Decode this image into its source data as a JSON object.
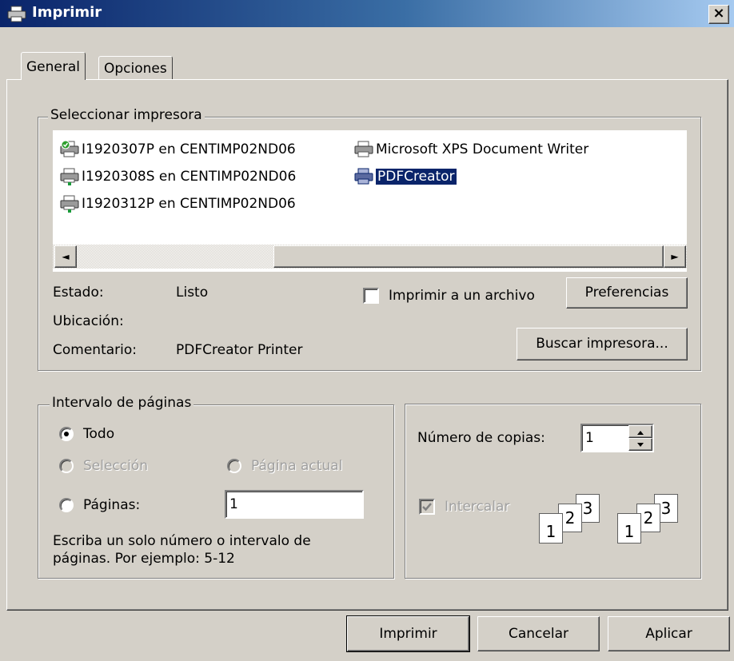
{
  "window": {
    "title": "Imprimir",
    "close_label": "×"
  },
  "tabs": [
    {
      "label": "General"
    },
    {
      "label": "Opciones"
    }
  ],
  "printer_group": {
    "legend": "Seleccionar impresora",
    "printers": [
      {
        "name": "I1920307P en CENTIMP02ND06"
      },
      {
        "name": "I1920308S en CENTIMP02ND06"
      },
      {
        "name": "I1920312P en CENTIMP02ND06"
      },
      {
        "name": "Microsoft XPS Document Writer"
      },
      {
        "name": "PDFCreator",
        "selected": true
      }
    ],
    "scroll_left": "◄",
    "scroll_right": "►",
    "status_label": "Estado:",
    "status_value": "Listo",
    "location_label": "Ubicación:",
    "location_value": "",
    "comment_label": "Comentario:",
    "comment_value": "PDFCreator Printer",
    "print_to_file_label": "Imprimir a un archivo",
    "preferences_button": "Preferencias",
    "find_printer_button": "Buscar impresora..."
  },
  "range_group": {
    "legend": "Intervalo de páginas",
    "all_label": "Todo",
    "selection_label": "Selección",
    "current_page_label": "Página actual",
    "pages_label": "Páginas:",
    "pages_value": "1",
    "hint": "Escriba un solo número o intervalo de páginas. Por ejemplo: 5-12"
  },
  "copies_group": {
    "copies_label": "Número de copias:",
    "copies_value": "1",
    "collate_label": "Intercalar",
    "collate_pages": [
      "1",
      "2",
      "3"
    ]
  },
  "footer": {
    "print_button": "Imprimir",
    "cancel_button": "Cancelar",
    "apply_button": "Aplicar"
  },
  "colors": {
    "title_gradient_start": "#0a246a",
    "title_gradient_end": "#a6caf0",
    "face": "#d4d0c8",
    "selection": "#0a246a"
  },
  "icons": {
    "title": "printer-icon",
    "printer": "printer-icon",
    "default_printer": "default-printer-icon"
  }
}
